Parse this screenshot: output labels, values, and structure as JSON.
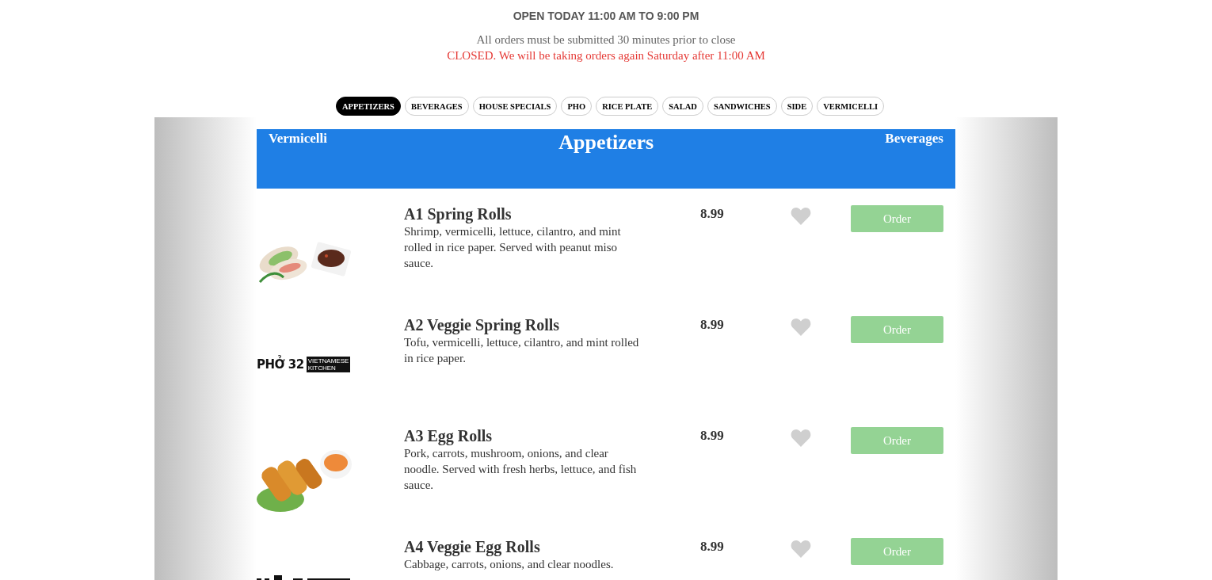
{
  "hours": "OPEN TODAY 11:00 AM TO 9:00 PM",
  "notice": "All orders must be submitted 30 minutes prior to close",
  "closed_notice": "CLOSED. We will be taking orders again Saturday after 11:00 AM",
  "tabs": [
    {
      "label": "APPETIZERS",
      "selected": true
    },
    {
      "label": "BEVERAGES",
      "selected": false
    },
    {
      "label": "HOUSE SPECIALS",
      "selected": false
    },
    {
      "label": "PHO",
      "selected": false
    },
    {
      "label": "RICE PLATE",
      "selected": false
    },
    {
      "label": "SALAD",
      "selected": false
    },
    {
      "label": "SANDWICHES",
      "selected": false
    },
    {
      "label": "SIDE",
      "selected": false
    },
    {
      "label": "VERMICELLI",
      "selected": false
    }
  ],
  "category_header": {
    "previous": "Vermicelli",
    "title": "Appetizers",
    "next": "Beverages"
  },
  "items": [
    {
      "name": "A1 Spring Rolls",
      "description": "Shrimp, vermicelli, lettuce, cilantro, and mint rolled in rice paper. Served with peanut miso sauce.",
      "price": "8.99",
      "favorite": false,
      "order_label": "Order"
    },
    {
      "image": {
        "kind": "logo",
        "brand": "PHỞ 32",
        "tagline": [
          "VIETNAMESE",
          "KITCHEN"
        ]
      },
      "name": "A2 Veggie Spring Rolls",
      "description": "Tofu, vermicelli, lettuce, cilantro, and mint rolled in rice paper.",
      "price": "8.99",
      "favorite": false,
      "order_label": "Order"
    },
    {
      "name": "A3 Egg Rolls",
      "description": "Pork, carrots, mushroom, onions, and clear noodle. Served with fresh herbs, lettuce, and fish sauce.",
      "price": "8.99",
      "favorite": false,
      "order_label": "Order"
    },
    {
      "image": {
        "kind": "logo_cut"
      },
      "name": "A4 Veggie Egg Rolls",
      "description": "Cabbage, carrots, onions, and clear noodles.",
      "price": "8.99",
      "favorite": false,
      "order_label": "Order"
    }
  ]
}
